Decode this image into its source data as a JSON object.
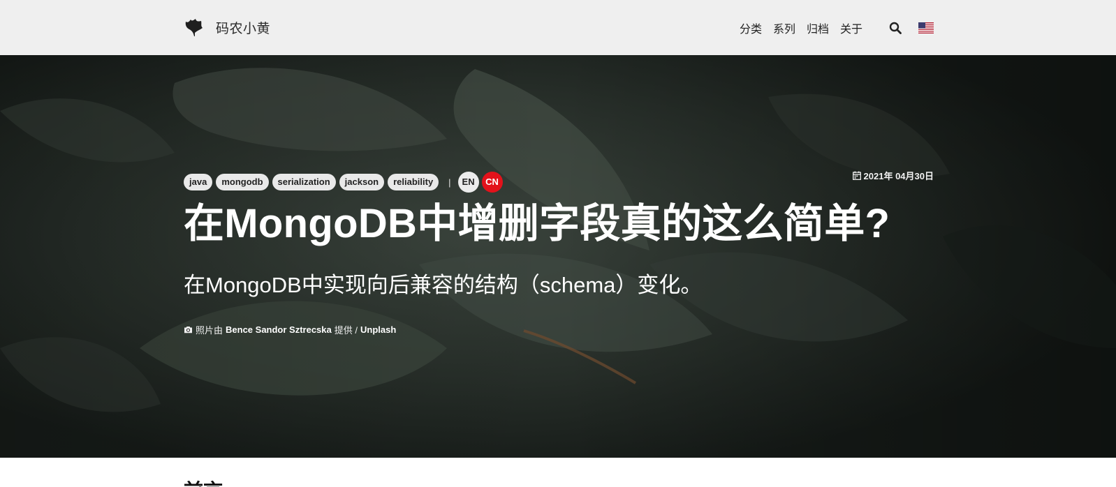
{
  "site": {
    "name": "码农小黄",
    "logo_icon": "ginkgo-leaf-icon"
  },
  "nav": {
    "items": [
      {
        "label": "分类"
      },
      {
        "label": "系列"
      },
      {
        "label": "归档"
      },
      {
        "label": "关于"
      }
    ],
    "search_icon": "search-icon",
    "language_flag": "us-flag-icon"
  },
  "post": {
    "tags": [
      "java",
      "mongodb",
      "serialization",
      "jackson",
      "reliability"
    ],
    "separator": "|",
    "languages": [
      {
        "label": "EN",
        "active": false
      },
      {
        "label": "CN",
        "active": true
      }
    ],
    "date": "2021年 04月30日",
    "title": "在MongoDB中增删字段真的这么简单?",
    "subtitle": "在MongoDB中实现向后兼容的结构（schema）变化。",
    "photo_credit": {
      "prefix": "照片由",
      "author": "Bence Sandor Sztrecska",
      "middle": "提供 /",
      "source": "Unplash"
    }
  },
  "content": {
    "first_heading": "前言"
  },
  "colors": {
    "navbar_bg": "#efefef",
    "hero_bg": "#1e2520",
    "tag_bg": "#e9e9e9",
    "lang_active_bg": "#e3121b",
    "text_light": "#ffffff"
  }
}
